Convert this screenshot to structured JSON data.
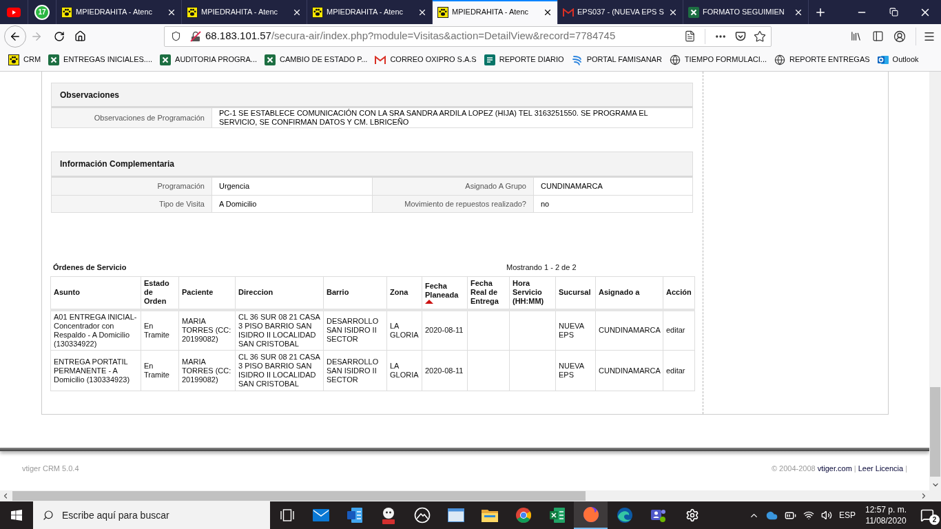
{
  "browser": {
    "tabs": [
      {
        "kind": "youtube",
        "selected": false
      },
      {
        "kind": "whatsapp",
        "badge": "17",
        "selected": false
      },
      {
        "kind": "crm",
        "title": "MPIEDRAHITA - Atenc",
        "selected": false
      },
      {
        "kind": "crm",
        "title": "MPIEDRAHITA - Atenc",
        "selected": false
      },
      {
        "kind": "crm",
        "title": "MPIEDRAHITA - Atenc",
        "selected": false
      },
      {
        "kind": "crm",
        "title": "MPIEDRAHITA - Atenc",
        "selected": true
      },
      {
        "kind": "gmail",
        "title": "EPS037 - (NUEVA EPS S",
        "selected": false
      },
      {
        "kind": "excel",
        "title": "FORMATO SEGUIMIEN",
        "selected": false
      }
    ],
    "toolbar": {
      "forward_disabled": true
    },
    "address": {
      "secure": false,
      "host": "68.183.101.57",
      "path": "/secura-air/index.php?module=Visitas&action=DetailView&record=7784745"
    },
    "bookmarks": [
      {
        "kind": "crm",
        "label": "CRM"
      },
      {
        "kind": "excel",
        "label": "ENTREGAS INICIALES...."
      },
      {
        "kind": "excel",
        "label": "AUDITORIA PROGRA..."
      },
      {
        "kind": "excel",
        "label": "CAMBIO DE ESTADO P..."
      },
      {
        "kind": "gmail",
        "label": "CORREO OXIPRO S.A.S"
      },
      {
        "kind": "forms",
        "label": "REPORTE DIARIO"
      },
      {
        "kind": "famisanar",
        "label": "PORTAL FAMISANAR"
      },
      {
        "kind": "globe",
        "label": "TIEMPO FORMULACI..."
      },
      {
        "kind": "globe",
        "label": "REPORTE ENTREGAS"
      },
      {
        "kind": "outlook",
        "label": "Outlook"
      }
    ]
  },
  "page": {
    "observations": {
      "title": "Observaciones",
      "fields": [
        {
          "label": "Observaciones de Programación",
          "value": "PC-1 SE ESTABLECE COMUNICACIÓN CON LA SRA SANDRA ARDILA LOPEZ (HIJA) TEL 3163251550. SE PROGRAMA EL SERVICIO, SE CONFIRMAN DATOS Y CM. LBRICEÑO"
        }
      ]
    },
    "complementary": {
      "title": "Información Complementaria",
      "rows": [
        [
          {
            "label": "Programación",
            "value": "Urgencia"
          },
          {
            "label": "Asignado A Grupo",
            "value": "CUNDINAMARCA"
          }
        ],
        [
          {
            "label": "Tipo de Visita",
            "value": "A Domicilio"
          },
          {
            "label": "Movimiento de repuestos realizado?",
            "value": "no"
          }
        ]
      ]
    },
    "service_orders": {
      "title": "Órdenes de Servicio",
      "count": "Mostrando 1 - 2 de 2",
      "columns": [
        {
          "label": "Asunto",
          "kind": "text",
          "sorted": false
        },
        {
          "label": "Estado de Orden",
          "kind": "text",
          "sorted": false
        },
        {
          "label": "Paciente",
          "kind": "text",
          "sorted": false
        },
        {
          "label": "Direccion",
          "kind": "text",
          "sorted": false
        },
        {
          "label": "Barrio",
          "kind": "text",
          "sorted": false
        },
        {
          "label": "Zona",
          "kind": "text",
          "sorted": false
        },
        {
          "label": "Fecha Planeada",
          "kind": "text",
          "sorted": true
        },
        {
          "label": "Fecha Real de Entrega",
          "kind": "text",
          "sorted": false
        },
        {
          "label": "Hora Servicio (HH:MM)",
          "kind": "text",
          "sorted": false
        },
        {
          "label": "Sucursal",
          "kind": "text",
          "sorted": false
        },
        {
          "label": "Asignado a",
          "kind": "text",
          "sorted": false
        },
        {
          "label": "Acción",
          "kind": "link",
          "sorted": false
        }
      ],
      "rows": [
        {
          "cells": [
            "A01 ENTREGA INICIAL-Concentrador con Respaldo - A Domicilio (130334922)",
            "En Tramite",
            "MARIA TORRES (CC: 20199082)",
            "CL 36 SUR 08 21 CASA 3 PISO BARRIO SAN ISIDRO II LOCALIDAD SAN CRISTOBAL",
            "DESARROLLO SAN ISIDRO II SECTOR",
            "LA GLORIA",
            "2020-08-11",
            null,
            null,
            "NUEVA EPS",
            "CUNDINAMARCA",
            "editar"
          ]
        },
        {
          "cells": [
            "ENTREGA PORTATIL PERMANENTE - A Domicilio (130334923)",
            "En Tramite",
            "MARIA TORRES (CC: 20199082)",
            "CL 36 SUR 08 21 CASA 3 PISO BARRIO SAN ISIDRO II LOCALIDAD SAN CRISTOBAL",
            "DESARROLLO SAN ISIDRO II SECTOR",
            "LA GLORIA",
            "2020-08-11",
            null,
            null,
            "NUEVA EPS",
            "CUNDINAMARCA",
            "editar"
          ]
        }
      ]
    },
    "footer": {
      "version": "vtiger CRM 5.0.4",
      "items": [
        {
          "kind": "text",
          "text": "© 2004-2008"
        },
        {
          "kind": "link",
          "text": "vtiger.com"
        },
        {
          "kind": "separator",
          "text": "|"
        },
        {
          "kind": "link",
          "text": "Leer Licencia"
        },
        {
          "kind": "separator",
          "text": "|"
        }
      ]
    }
  },
  "taskbar": {
    "search_placeholder": "Escribe aquí para buscar",
    "apps": [
      {
        "kind": "task-view",
        "active": false
      },
      {
        "kind": "mail",
        "active": false
      },
      {
        "kind": "word",
        "active": false
      },
      {
        "kind": "mascot",
        "active": false
      },
      {
        "kind": "photos",
        "active": false
      },
      {
        "kind": "window",
        "active": false
      },
      {
        "kind": "explorer",
        "active": false
      },
      {
        "kind": "chrome",
        "active": false
      },
      {
        "kind": "excel",
        "active": false
      },
      {
        "kind": "firefox",
        "active": true
      },
      {
        "kind": "edge",
        "active": false
      },
      {
        "kind": "teams",
        "active": false
      },
      {
        "kind": "settings",
        "active": false
      }
    ],
    "language": "ESP",
    "time": "12:57 p. m.",
    "date": "11/08/2020",
    "notifications": "2"
  }
}
